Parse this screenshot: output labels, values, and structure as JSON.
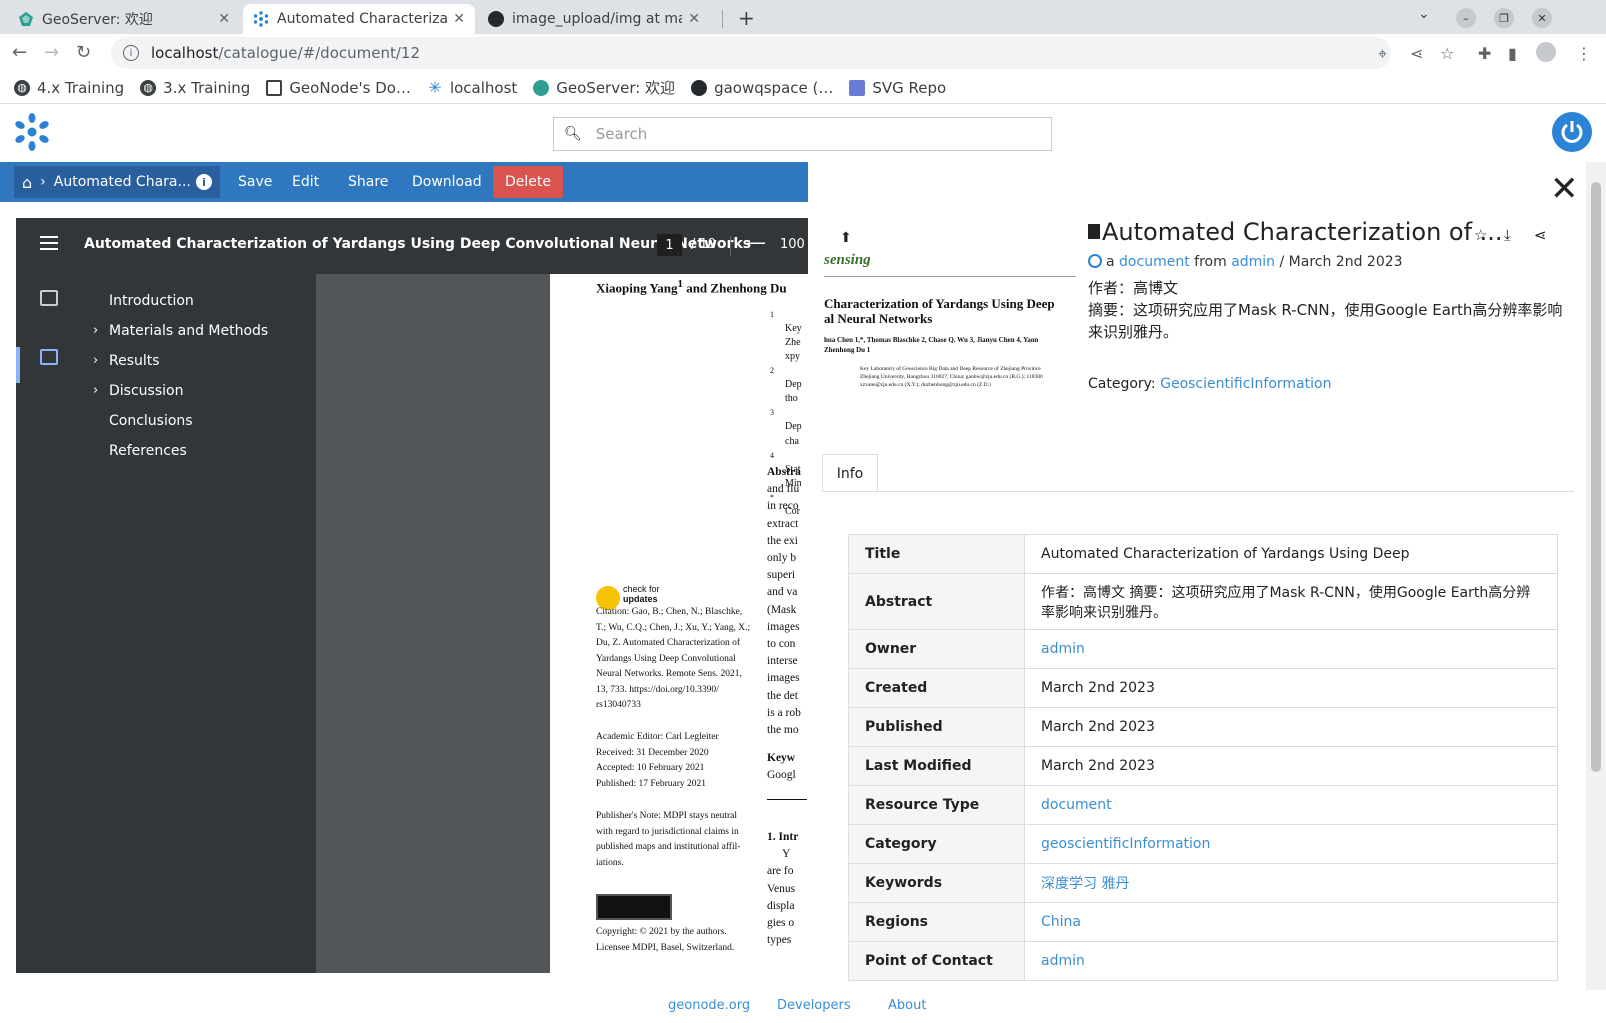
{
  "browser": {
    "tabs": [
      {
        "title": "GeoServer: 欢迎",
        "icon": "geoserver-icon"
      },
      {
        "title": "Automated Characterizat",
        "icon": "geonode-icon"
      },
      {
        "title": "image_upload/img at mai",
        "icon": "github-icon"
      }
    ],
    "url_host": "localhost",
    "url_path": "/catalogue/#/document/12",
    "bookmarks": [
      {
        "label": "4.x Training",
        "icon": "globe-icon"
      },
      {
        "label": "3.x Training",
        "icon": "globe-icon"
      },
      {
        "label": "GeoNode's Do…",
        "icon": "docs-icon"
      },
      {
        "label": "localhost",
        "icon": "geonode-icon"
      },
      {
        "label": "GeoServer: 欢迎",
        "icon": "geoserver-icon"
      },
      {
        "label": "gaowqspace (…",
        "icon": "github-icon"
      },
      {
        "label": "SVG Repo",
        "icon": "svgrepo-icon"
      }
    ]
  },
  "header": {
    "search_placeholder": "Search"
  },
  "toolbar": {
    "breadcrumb_label": "Automated Chara...",
    "save": "Save",
    "edit": "Edit",
    "share": "Share",
    "download": "Download",
    "delete": "Delete",
    "accent": "#2f78c0",
    "danger": "#d9534f"
  },
  "viewer": {
    "title": "Automated Characterization of Yardangs Using Deep Convolutional Neural Networks",
    "page": "1",
    "page_total": "/ 19",
    "zoom": "100",
    "outline": [
      {
        "label": "Introduction",
        "expandable": false
      },
      {
        "label": "Materials and Methods",
        "expandable": true
      },
      {
        "label": "Results",
        "expandable": true
      },
      {
        "label": "Discussion",
        "expandable": true
      },
      {
        "label": "Conclusions",
        "expandable": false
      },
      {
        "label": "References",
        "expandable": false
      }
    ],
    "paper": {
      "authors_line": "Xiaoping Yang",
      "authors_line_tail": " and Zhenhong Du",
      "check_updates_1": "check for",
      "check_updates_2": "updates",
      "citation": [
        "Citation:  Gao, B.; Chen, N.; Blaschke,",
        "T.; Wu, C.Q.; Chen, J.; Xu, Y.; Yang, X.;",
        "Du, Z. Automated Characterization of",
        "Yardangs Using Deep Convolutional",
        "Neural Networks. Remote Sens. 2021,",
        "13, 733. https://doi.org/10.3390/",
        "rs13040733"
      ],
      "editor": [
        "Academic Editor: Carl Legleiter",
        "Received: 31 December 2020",
        "Accepted: 10 February 2021",
        "Published: 17 February 2021"
      ],
      "publisher_note": [
        "Publisher's Note: MDPI stays neutral",
        "with regard to jurisdictional claims in",
        "published maps and institutional affil-",
        "iations."
      ],
      "copyright": [
        "Copyright: © 2021 by the authors.",
        "Licensee MDPI, Basel, Switzerland."
      ],
      "right_col": [
        "1",
        "Key",
        "Zhe",
        "xpy",
        "2",
        "Dep",
        "tho",
        "3",
        "Dep",
        "cha",
        "4",
        "Stat",
        "Min",
        "*",
        "Cor"
      ],
      "abstract_col": [
        "Abstra",
        "and flu",
        "in reco",
        "extract",
        "the exi",
        "only b",
        "superi",
        "and va",
        "(Mask",
        "images",
        "to con",
        "interse",
        "images",
        "the det",
        "is a rob",
        "the mo"
      ],
      "keywords_col": [
        "Keyw",
        "Googl"
      ],
      "intro_col": [
        "1. Intr",
        "Y",
        "are fo",
        "Venus",
        "displa",
        "gies o",
        "types"
      ]
    }
  },
  "panel": {
    "title": "Automated Characterization of ...",
    "meta_a": "a",
    "meta_type": "document",
    "meta_from": "from",
    "meta_owner": "admin",
    "meta_date": "/ March 2nd 2023",
    "author_line": "作者：高博文",
    "abstract": "摘要：这项研究应用了Mask R-CNN，使用Google Earth高分辨率影响来识别雅丹。",
    "category_label": "Category:",
    "category_value": "GeoscientificInformation",
    "tab_info": "Info",
    "thumb": {
      "journal": "sensing",
      "title_1": "Characterization of Yardangs Using Deep",
      "title_2": "al Neural Networks",
      "authors_1": "hua Chen 1,*, Thomas Blaschke 2, Chase Q. Wu 3, Jianyu Chen 4, Yaon",
      "authors_2": "Zhenhong Du 1",
      "aff_1": "Key Laboratory of Geoscience Big Data and Deep Resource of Zhejiang Province",
      "aff_2": "Zhejiang University, Hangzhou 310027, China; gaobw@zju.edu.cn (B.G.); 118380",
      "aff_3": "xzvane@zju.edu.cn (X.Y.); duzhenhong@zju.edu.cn (Z.D.)"
    },
    "info": [
      {
        "key": "Title",
        "value": "Automated Characterization of Yardangs Using Deep",
        "link": false
      },
      {
        "key": "Abstract",
        "value": "作者：高博文 摘要：这项研究应用了Mask R-CNN，使用Google Earth高分辨率影响来识别雅丹。",
        "link": false
      },
      {
        "key": "Owner",
        "value": "admin",
        "link": true
      },
      {
        "key": "Created",
        "value": "March 2nd 2023",
        "link": false
      },
      {
        "key": "Published",
        "value": "March 2nd 2023",
        "link": false
      },
      {
        "key": "Last Modified",
        "value": "March 2nd 2023",
        "link": false
      },
      {
        "key": "Resource Type",
        "value": "document",
        "link": true
      },
      {
        "key": "Category",
        "value": "geoscientificInformation",
        "link": true
      },
      {
        "key": "Keywords",
        "value": "深度学习 雅丹",
        "link": true
      },
      {
        "key": "Regions",
        "value": "China",
        "link": true
      },
      {
        "key": "Point of Contact",
        "value": "admin",
        "link": true
      }
    ],
    "link_color": "#3a8ed6"
  },
  "footer": {
    "links": [
      "geonode.org",
      "Developers",
      "About"
    ]
  }
}
